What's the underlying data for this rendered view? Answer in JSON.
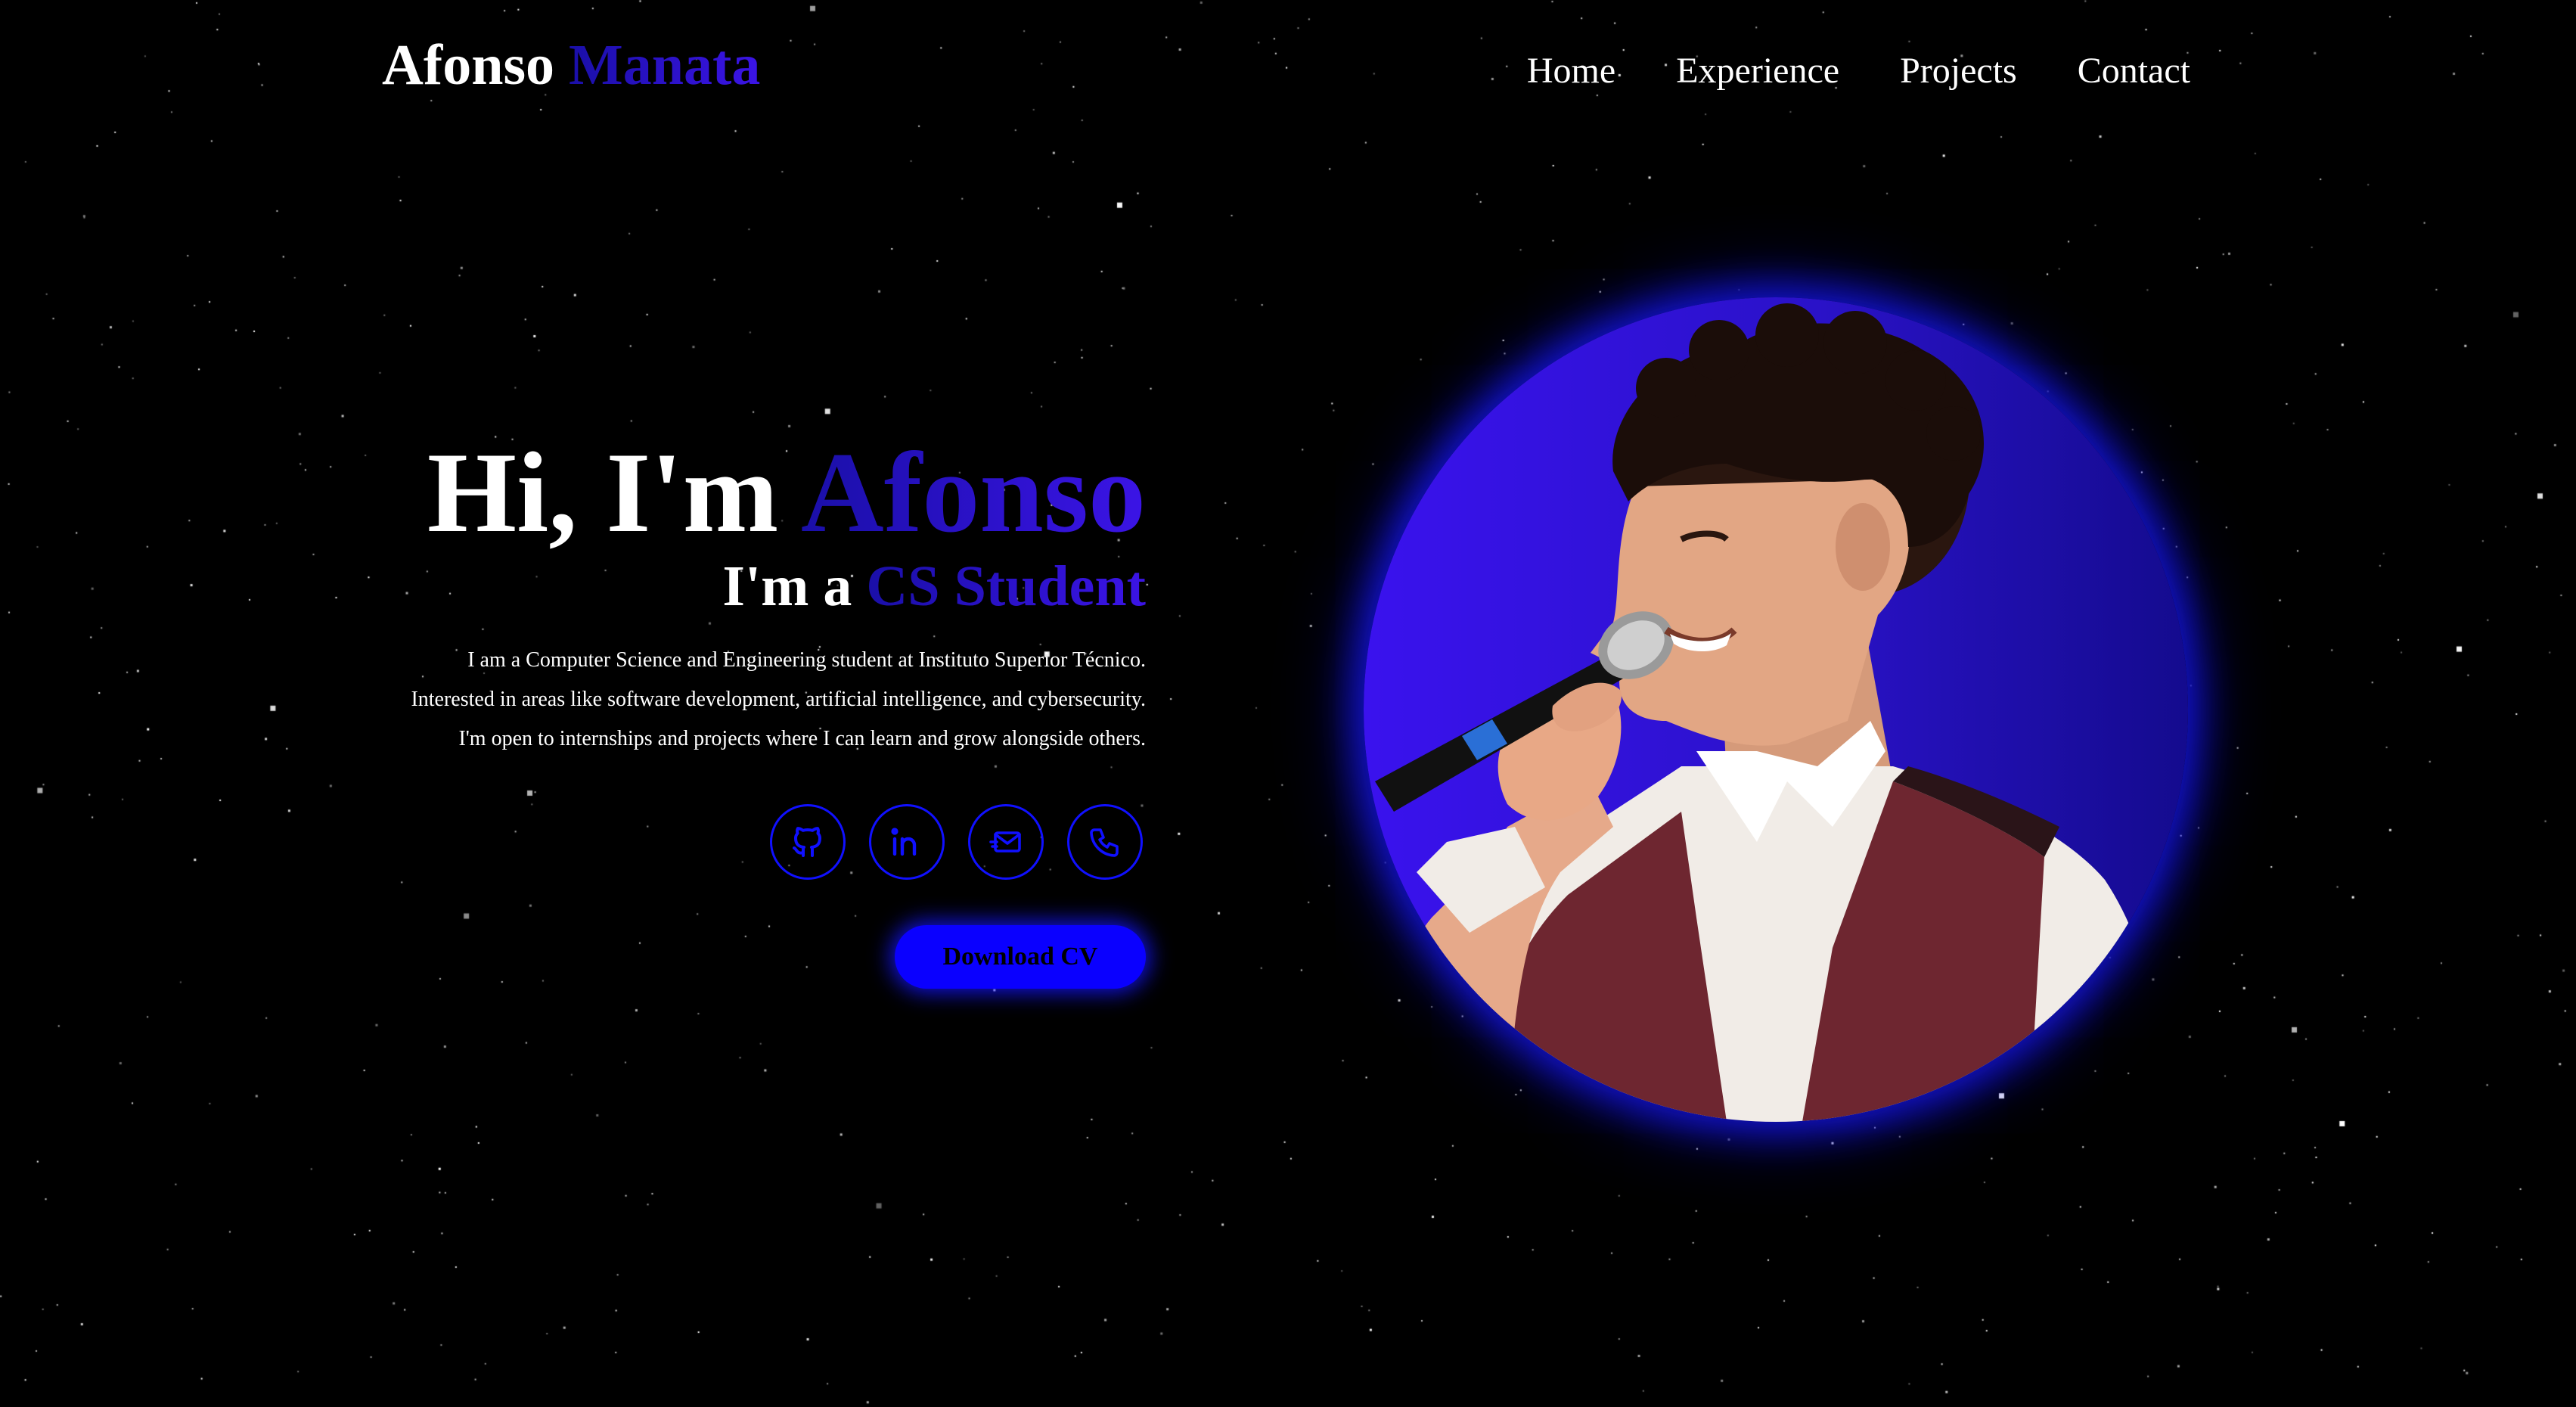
{
  "header": {
    "logo_first": "Afonso",
    "logo_last": "Manata",
    "nav": [
      "Home",
      "Experience",
      "Projects",
      "Contact"
    ]
  },
  "hero": {
    "greeting_prefix": "Hi, I'm",
    "greeting_name": "Afonso",
    "role_prefix": "I'm a",
    "role": "CS Student",
    "bio": [
      "I am a Computer Science and Engineering student at Instituto Superior Técnico.",
      "Interested in areas like software development, artificial intelligence, and cybersecurity.",
      "I'm open to internships and projects where I can learn and grow alongside others."
    ],
    "socials": [
      "github-icon",
      "linkedin-icon",
      "mail-icon",
      "phone-icon"
    ],
    "cv_label": "Download CV"
  },
  "colors": {
    "background": "#000000",
    "accent_start": "#1a0fa8",
    "accent_end": "#3b14e6",
    "button": "#0a00ff",
    "icon_stroke": "#1010ff"
  }
}
